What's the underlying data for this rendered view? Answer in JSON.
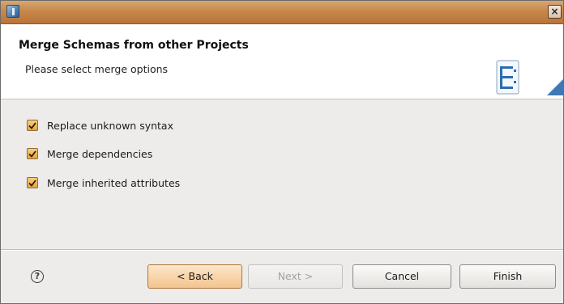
{
  "window": {
    "close_glyph": "×"
  },
  "header": {
    "title": "Merge Schemas from other Projects",
    "subtitle": "Please select merge options",
    "icon": "schema-wizard-icon"
  },
  "options": [
    {
      "label": "Replace unknown syntax",
      "checked": true
    },
    {
      "label": "Merge dependencies",
      "checked": true
    },
    {
      "label": "Merge inherited attributes",
      "checked": true
    }
  ],
  "footer": {
    "help_glyph": "?",
    "back_label": "< Back",
    "next_label": "Next >",
    "cancel_label": "Cancel",
    "finish_label": "Finish"
  },
  "colors": {
    "titlebar": "#c8874a",
    "checkbox": "#e7a53c",
    "default_button": "#f3c48f"
  }
}
